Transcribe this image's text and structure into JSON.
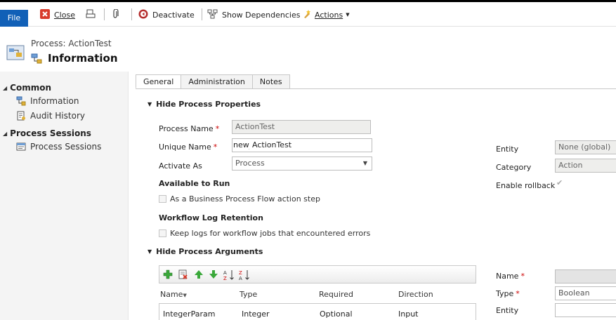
{
  "toolbar": {
    "file": "File",
    "close": "Close",
    "deactivate": "Deactivate",
    "show_dependencies": "Show Dependencies",
    "actions": "Actions"
  },
  "header": {
    "entity_label": "Process: ActionTest",
    "title": "Information"
  },
  "nav": {
    "common": "Common",
    "information": "Information",
    "audit_history": "Audit History",
    "process_sessions_head": "Process Sessions",
    "process_sessions": "Process Sessions"
  },
  "tabs": [
    "General",
    "Administration",
    "Notes"
  ],
  "props": {
    "section": "Hide Process Properties",
    "process_name_label": "Process Name",
    "process_name": "ActionTest",
    "unique_name_label": "Unique Name",
    "unique_prefix": "new_",
    "unique_name": "ActionTest",
    "activate_as_label": "Activate As",
    "activate_as": "Process",
    "available_label": "Available to Run",
    "bpf_label": "As a Business Process Flow action step",
    "log_label": "Workflow Log Retention",
    "log_chk": "Keep logs for workflow jobs that encountered errors",
    "entity_label": "Entity",
    "entity": "None (global)",
    "category_label": "Category",
    "category": "Action",
    "rollback_label": "Enable rollback"
  },
  "args": {
    "section": "Hide Process Arguments",
    "columns": [
      "Name",
      "Type",
      "Required",
      "Direction"
    ],
    "rows": [
      {
        "name": "IntegerParam",
        "type": "Integer",
        "required": "Optional",
        "direction": "Input"
      }
    ],
    "detail": {
      "name_label": "Name",
      "type_label": "Type",
      "type_value": "Boolean",
      "entity_label": "Entity"
    }
  },
  "colors": {
    "file_button": "#1160b7",
    "required": "#cc0000"
  }
}
